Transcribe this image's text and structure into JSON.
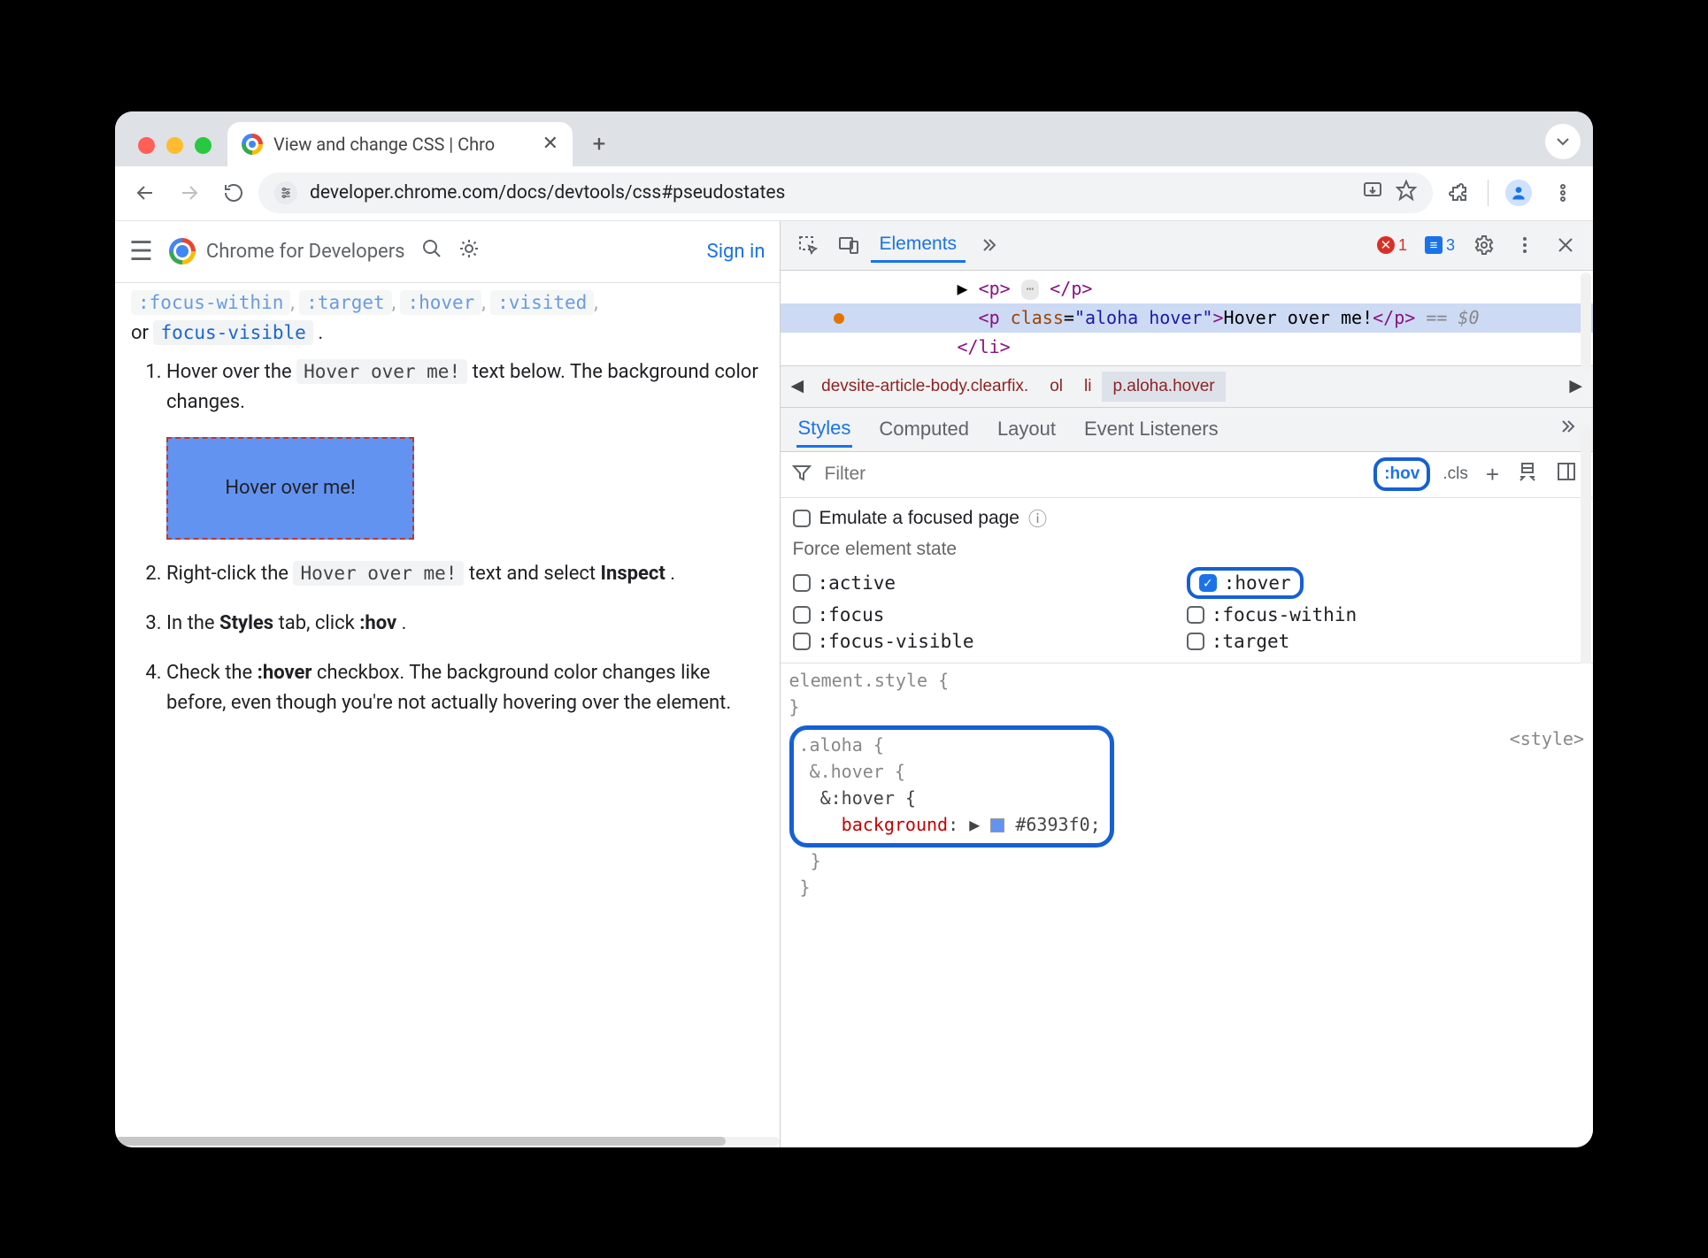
{
  "browser": {
    "tab_title": "View and change CSS  |  Chro",
    "new_tab": "+",
    "url": "developer.chrome.com/docs/devtools/css#pseudostates"
  },
  "page": {
    "brand": "Chrome for Developers",
    "signin": "Sign in",
    "prev_fragment_or": "or ",
    "prev_fragment_code": "focus-visible",
    "prev_fragment_dot": ".",
    "steps": {
      "s1a": "Hover over the ",
      "code1": "Hover over me!",
      "s1b": " text below. The background color changes.",
      "hoverbox": "Hover over me!",
      "s2a": "Right-click the ",
      "code2": "Hover over me!",
      "s2b": " text and select ",
      "s2bold": "Inspect",
      "s2dot": ".",
      "s3a": "In the ",
      "s3bold1": "Styles",
      "s3b": " tab, click ",
      "s3bold2": ":hov",
      "s3dot": ".",
      "s4a": "Check the ",
      "s4bold": ":hover",
      "s4b": " checkbox. The background color changes like before, even though you're not actually hovering over the element."
    }
  },
  "devtools": {
    "tabs": {
      "elements": "Elements"
    },
    "errors": "1",
    "messages": "3",
    "dom": {
      "l1_open": "<p>",
      "l1_close": "</p>",
      "l2a": "<p ",
      "l2attr": "class",
      "l2eq": "=",
      "l2val": "\"aloha hover\"",
      "l2b": ">",
      "l2text": "Hover over me!",
      "l2c": "</p>",
      "l2eq0": " == $0",
      "l3": "</li>"
    },
    "bc": {
      "b1": "devsite-article-body.clearfix.",
      "b2": "ol",
      "b3": "li",
      "b4": "p.aloha.hover"
    },
    "subtabs": {
      "styles": "Styles",
      "computed": "Computed",
      "layout": "Layout",
      "ev": "Event Listeners"
    },
    "filter_placeholder": "Filter",
    "hov": ":hov",
    "cls": ".cls",
    "emulate": "Emulate a focused page",
    "force_title": "Force element state",
    "states": {
      "active": ":active",
      "hover": ":hover",
      "focus": ":focus",
      "fw": ":focus-within",
      "fv": ":focus-visible",
      "target": ":target"
    },
    "rules": {
      "elstyle": "element.style {",
      "brace": "}",
      "src": "<style>",
      "sel1": ".aloha {",
      "sel2": "&.hover {",
      "sel3": "&:hover {",
      "prop_name": "background",
      "prop_val": "#6393f0",
      "colon": ": ",
      "semi": ";"
    }
  }
}
